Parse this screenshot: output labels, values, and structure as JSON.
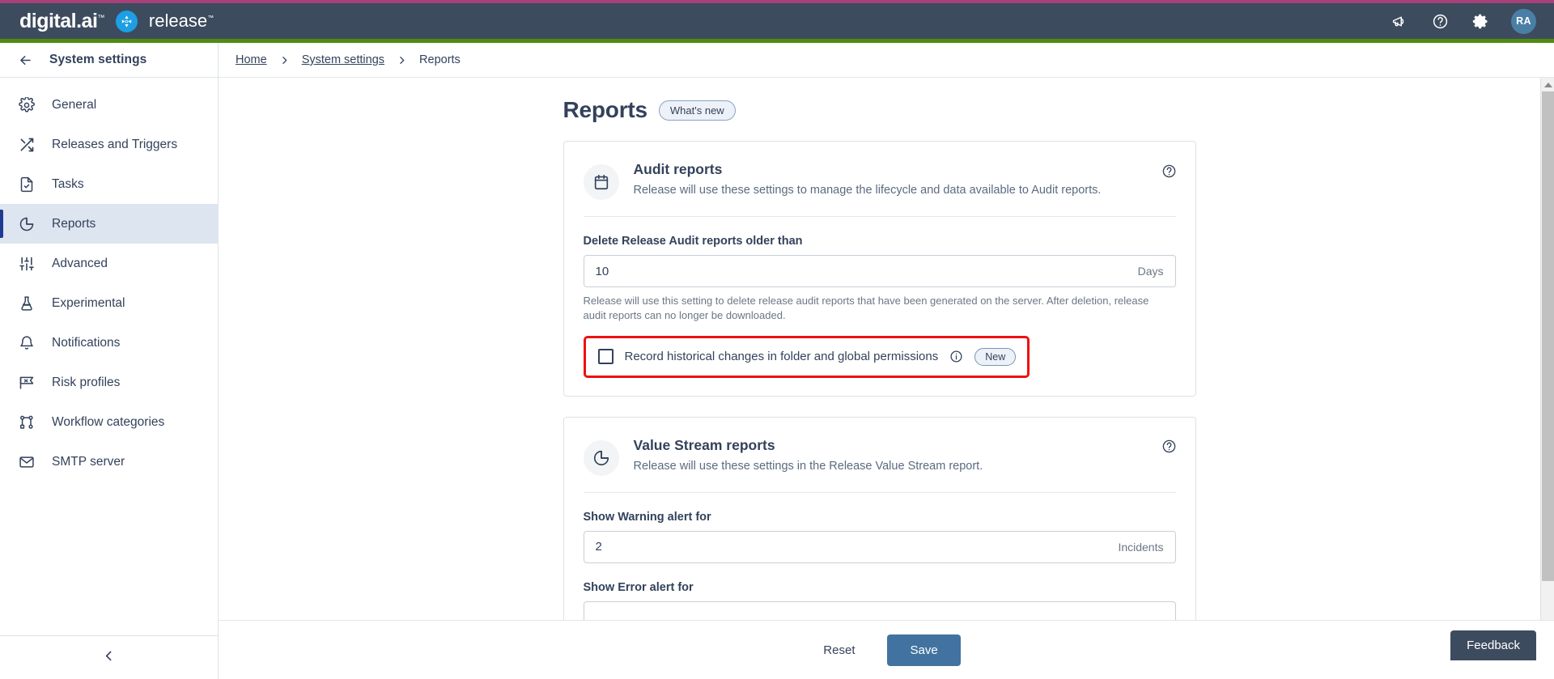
{
  "theme": {
    "header_bg": "#3d4b5e",
    "top_accent": "#a8417a",
    "green_accent": "#4f8c10",
    "primary_button": "#4273a0",
    "active_nav_bg": "#dde5f0",
    "highlight_box": "#ee1111",
    "text": "#33425b"
  },
  "header": {
    "brand_primary": "digital.ai",
    "brand_secondary": "release",
    "icons": [
      {
        "name": "announcement-icon",
        "label": "Announcements"
      },
      {
        "name": "help-icon",
        "label": "Help"
      },
      {
        "name": "gear-icon",
        "label": "Settings"
      }
    ],
    "avatar_initials": "RA"
  },
  "sidebar": {
    "title": "System settings",
    "back_icon": "arrow-left-icon",
    "collapse_icon": "chevron-left-icon",
    "items": [
      {
        "label": "General",
        "icon": "gear-icon",
        "active": false
      },
      {
        "label": "Releases and Triggers",
        "icon": "shuffle-icon",
        "active": false
      },
      {
        "label": "Tasks",
        "icon": "document-check-icon",
        "active": false
      },
      {
        "label": "Reports",
        "icon": "pie-chart-icon",
        "active": true
      },
      {
        "label": "Advanced",
        "icon": "sliders-icon",
        "active": false
      },
      {
        "label": "Experimental",
        "icon": "flask-icon",
        "active": false
      },
      {
        "label": "Notifications",
        "icon": "bell-icon",
        "active": false
      },
      {
        "label": "Risk profiles",
        "icon": "risk-flag-icon",
        "active": false
      },
      {
        "label": "Workflow categories",
        "icon": "workflow-nodes-icon",
        "active": false
      },
      {
        "label": "SMTP server",
        "icon": "envelope-icon",
        "active": false
      }
    ]
  },
  "breadcrumb": {
    "items": [
      {
        "label": "Home",
        "link": true
      },
      {
        "label": "System settings",
        "link": true
      },
      {
        "label": "Reports",
        "link": false
      }
    ],
    "separator": "›"
  },
  "page": {
    "title": "Reports",
    "whats_new_badge": "What's new"
  },
  "cards": [
    {
      "id": "audit-reports",
      "icon": "calendar-icon",
      "title": "Audit reports",
      "description": "Release will use these settings to manage the lifecycle and data available to Audit reports.",
      "help_icon": "question-circle-icon",
      "field": {
        "label": "Delete Release Audit reports older than",
        "value": "10",
        "suffix": "Days",
        "help_text": "Release will use this setting to delete release audit reports that have been generated on the server. After deletion, release audit reports can no longer be downloaded."
      },
      "checkbox": {
        "label": "Record historical changes in folder and global permissions",
        "checked": false,
        "info_icon": "info-circle-icon",
        "badge": "New",
        "highlighted": true
      }
    },
    {
      "id": "value-stream-reports",
      "icon": "pie-chart-icon",
      "title": "Value Stream reports",
      "description": "Release will use these settings in the Release Value Stream report.",
      "help_icon": "question-circle-icon",
      "fields": [
        {
          "label": "Show Warning alert for",
          "value": "2",
          "suffix": "Incidents"
        },
        {
          "label": "Show Error alert for",
          "value": "",
          "suffix": ""
        }
      ]
    }
  ],
  "footer": {
    "reset_label": "Reset",
    "save_label": "Save",
    "feedback_label": "Feedback"
  },
  "scrollbar": {
    "up_arrow": "triangle-up-icon",
    "down_arrow": "triangle-down-icon"
  }
}
